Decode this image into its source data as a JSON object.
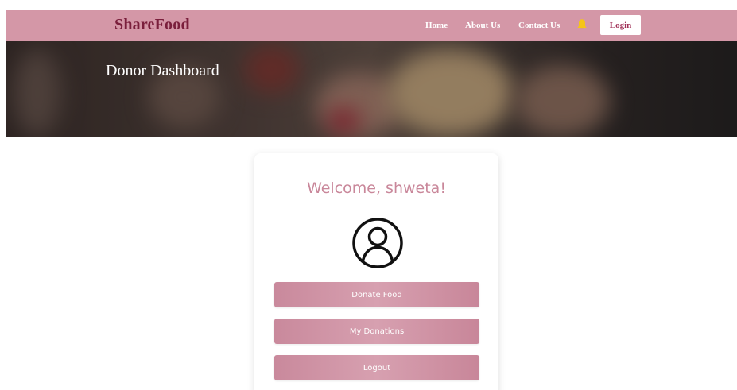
{
  "navbar": {
    "brand": "ShareFood",
    "links": [
      "Home",
      "About Us",
      "Contact Us"
    ],
    "login_label": "Login",
    "bell_icon": "bell-icon"
  },
  "hero": {
    "title": "Donor Dashboard"
  },
  "card": {
    "welcome": "Welcome, shweta!",
    "avatar_icon": "user-avatar-icon",
    "buttons": [
      "Donate Food",
      "My Donations",
      "Logout"
    ]
  },
  "colors": {
    "navbar_bg": "#d497a7",
    "brand": "#7a1f3c",
    "accent": "#c9879a",
    "button": "#cf93a5",
    "bell": "#f5c518"
  }
}
